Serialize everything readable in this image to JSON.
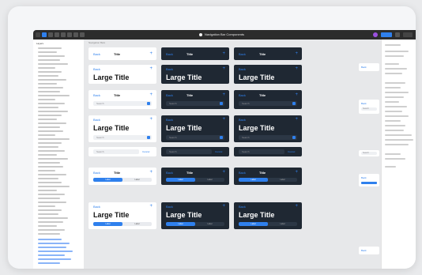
{
  "app": {
    "doc_title": "Navigation Bar Components"
  },
  "toolbar": {
    "tools": [
      "menu-icon",
      "move-icon",
      "frame-icon",
      "shape-icon",
      "pen-icon",
      "text-icon",
      "hand-icon",
      "comment-icon"
    ],
    "right": [
      "avatar",
      "share-button",
      "play-icon",
      "zoom"
    ]
  },
  "left_panel": {
    "header": "Layers"
  },
  "canvas": {
    "page_label": "Navigation Bars"
  },
  "nav": {
    "back_label": "Back",
    "title_label": "Title",
    "large_title": "Large Title",
    "search_placeholder": "Search",
    "cancel_label": "Cancel",
    "segment_a": "Label",
    "segment_b": "Label"
  },
  "colors": {
    "accent": "#2f80ed",
    "dark_bg": "#1f2833",
    "light_bg": "#ffffff",
    "toolbar_bg": "#2c2c2c"
  }
}
